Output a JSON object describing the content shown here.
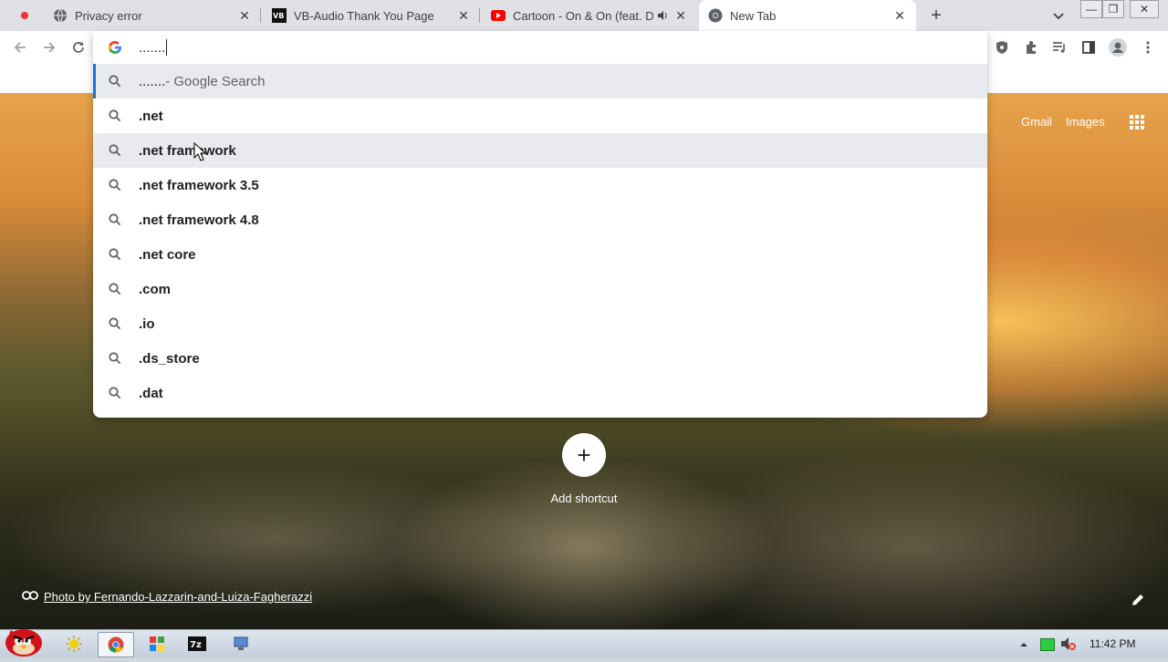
{
  "browser": {
    "tabs": [
      {
        "title": "Privacy error",
        "icon": "globe-icon"
      },
      {
        "title": "VB-Audio Thank You Page",
        "icon": "vb-audio-icon"
      },
      {
        "title": "Cartoon - On & On (feat. D",
        "icon": "youtube-icon"
      },
      {
        "title": "New Tab",
        "icon": "chrome-icon"
      }
    ],
    "omnibox": {
      "input_value": ".......",
      "suggestions": [
        {
          "typed": ".......",
          "rest": " - Google Search"
        },
        {
          "typed": "",
          "rest": ".net"
        },
        {
          "typed": "",
          "rest": ".net framework"
        },
        {
          "typed": "",
          "rest": ".net framework 3.5"
        },
        {
          "typed": "",
          "rest": ".net framework 4.8"
        },
        {
          "typed": "",
          "rest": ".net core"
        },
        {
          "typed": "",
          "rest": ".com"
        },
        {
          "typed": "",
          "rest": ".io"
        },
        {
          "typed": "",
          "rest": ".ds_store"
        },
        {
          "typed": "",
          "rest": ".dat"
        }
      ]
    }
  },
  "ntp": {
    "gmail": "Gmail",
    "images": "Images",
    "add_shortcut": "Add shortcut",
    "photo_credit": "Photo by Fernando-Lazzarin-and-Luiza-Fagherazzi"
  },
  "taskbar": {
    "clock": "11:42 PM"
  },
  "colors": {
    "accent": "#1a73e8",
    "tab_strip": "#dfe1e5",
    "youtube_red": "#ff0000"
  }
}
